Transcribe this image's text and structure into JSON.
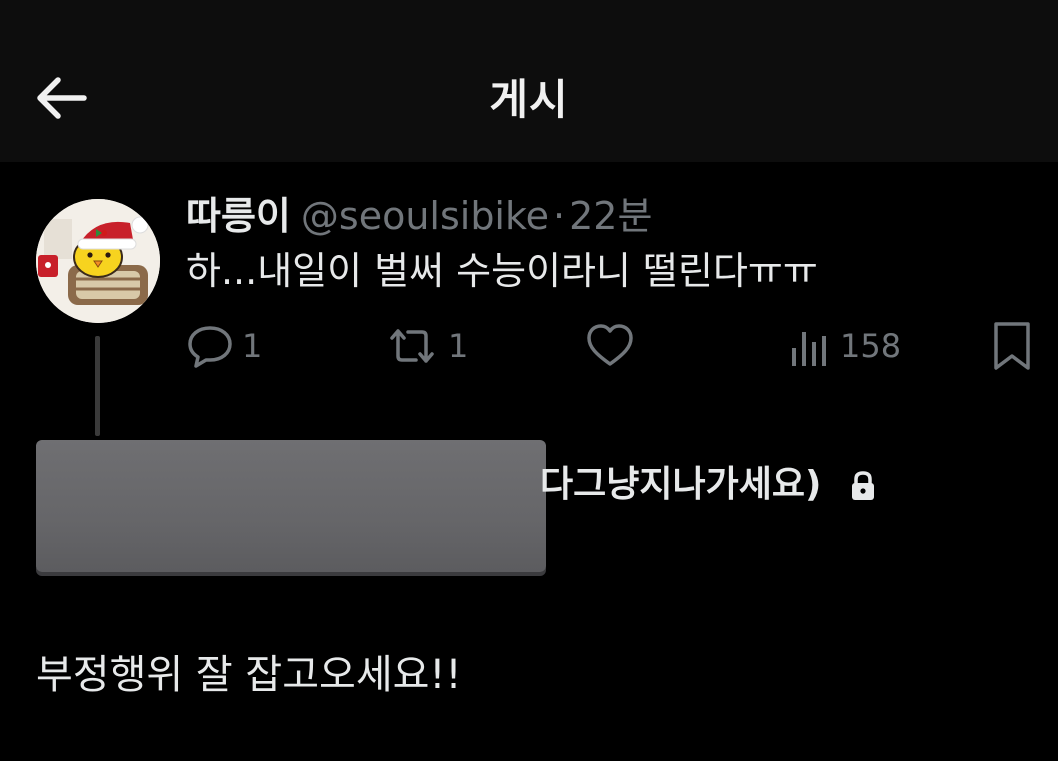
{
  "header": {
    "title": "게시",
    "back_icon": "arrow-left-icon"
  },
  "tweet": {
    "display_name": "따릉이",
    "handle": "@seoulsibike",
    "separator": "·",
    "time": "22분",
    "text": "하...내일이 벌써 수능이라니 떨린다ㅠㅠ",
    "avatar_icon": "chick-santa-avatar",
    "actions": {
      "reply_count": "1",
      "retweet_count": "1",
      "views_count": "158"
    }
  },
  "reply": {
    "visible_name_fragment": "다그냥지나가세요)",
    "protected_icon": "lock-icon",
    "text": "부정행위 잘 잡고오세요!!"
  },
  "colors": {
    "background": "#000000",
    "header_background": "#0d0d0d",
    "text": "#e7e9ea",
    "muted": "#71767b",
    "redaction": "#6a6a6d"
  }
}
